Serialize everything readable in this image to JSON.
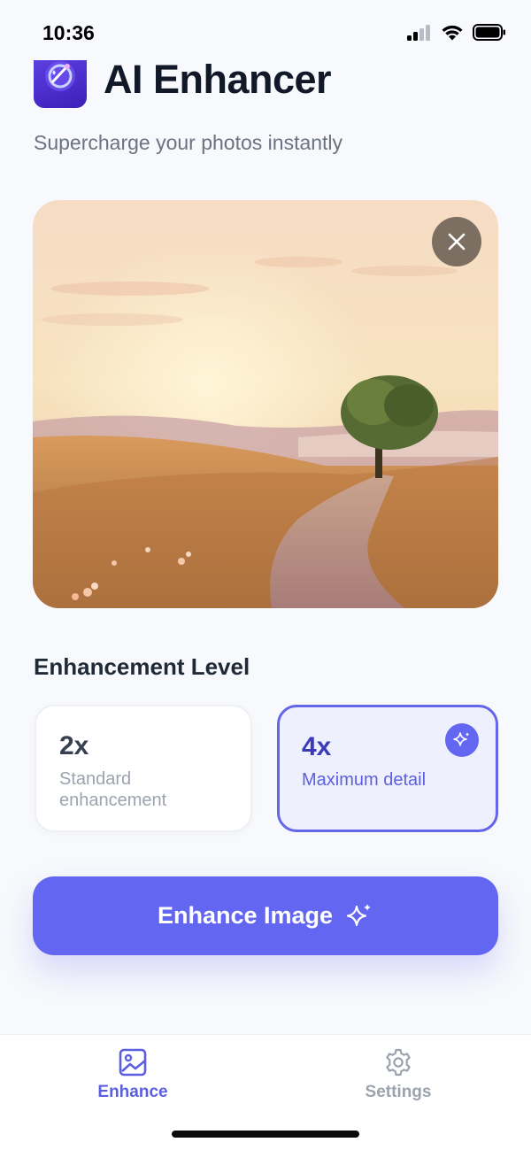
{
  "status_bar": {
    "time": "10:36",
    "icons": [
      "cellular-signal-icon",
      "wifi-icon",
      "battery-icon"
    ]
  },
  "header": {
    "app_icon": "app-logo-icon",
    "title": "AI Enhancer",
    "subtitle": "Supercharge your photos instantly"
  },
  "preview": {
    "image": "landscape-sunset-tree-path",
    "close_icon": "close-icon"
  },
  "enhancement": {
    "section_title": "Enhancement Level",
    "options": [
      {
        "value": "2x",
        "description": "Standard enhancement",
        "selected": false
      },
      {
        "value": "4x",
        "description": "Maximum detail",
        "selected": true,
        "badge_icon": "sparkle-icon"
      }
    ]
  },
  "action": {
    "label": "Enhance Image",
    "icon": "sparkle-icon"
  },
  "tab_bar": {
    "tabs": [
      {
        "label": "Enhance",
        "icon": "image-icon",
        "active": true
      },
      {
        "label": "Settings",
        "icon": "gear-icon",
        "active": false
      }
    ]
  },
  "colors": {
    "accent": "#6366f1",
    "title_text": "#111827",
    "muted_text": "#6b7280",
    "background": "#f7f9fc"
  }
}
